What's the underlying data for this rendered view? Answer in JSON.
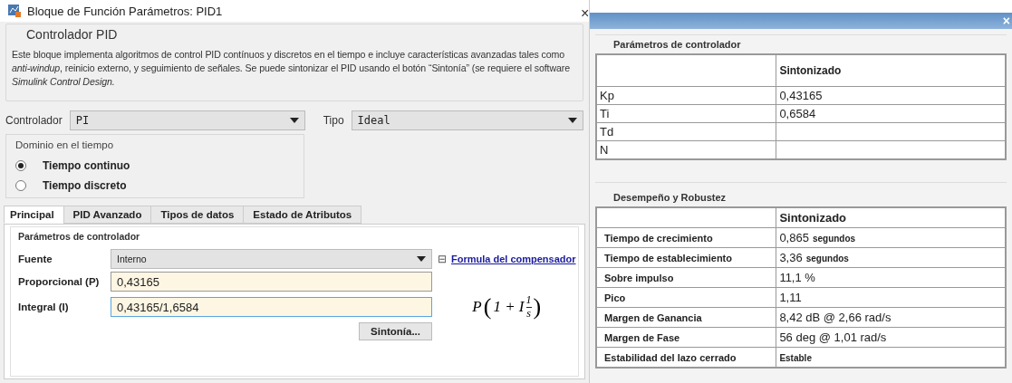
{
  "dialog": {
    "title": "Bloque de Función Parámetros: PID1",
    "close": "×",
    "section": {
      "title": "Controlador PID",
      "description": "Este bloque implementa algoritmos de control PID contínuos y discretos en el tiempo e incluye características avanzadas tales como *anti-windup*, reinicio externo, y seguimiento de señales. Se puede sintonizar el PID usando el botón “Sintonía” (se requiere el software *Simulink Control Design.*"
    },
    "controller": {
      "label": "Controlador",
      "value": "PI"
    },
    "type": {
      "label": "Tipo",
      "value": "Ideal"
    },
    "time_domain": {
      "title": "Dominio en el tiempo",
      "options": [
        {
          "label": "Tiempo continuo",
          "selected": true
        },
        {
          "label": "Tiempo discreto",
          "selected": false
        }
      ]
    },
    "tabs": [
      {
        "label": "Principal",
        "selected": true
      },
      {
        "label": "PID Avanzado",
        "selected": false
      },
      {
        "label": "Tipos de datos",
        "selected": false
      },
      {
        "label": "Estado de Atributos",
        "selected": false
      }
    ],
    "params": {
      "title": "Parámetros de controlador",
      "source": {
        "label": "Fuente",
        "value": "Interno"
      },
      "fields": [
        {
          "label": "Proporcional (P)",
          "value": "0,43165",
          "focused": false
        },
        {
          "label": "Integral (I)",
          "value": "0,43165/1,6584",
          "focused": true
        }
      ],
      "formula_toggle": "⊟",
      "formula_link": "Formula del compensador",
      "formula": {
        "lead": "P",
        "open": "(",
        "inner": "1 + I",
        "numerator": "1",
        "denominator": "s",
        "close": ")"
      },
      "tune_button": "Sintonía..."
    }
  },
  "results": {
    "close": "×",
    "controller_params": {
      "title": "Parámetros de controlador",
      "header": "Sintonizado",
      "rows": [
        {
          "name": "Kp",
          "value": "0,43165"
        },
        {
          "name": "Ti",
          "value": "0,6584"
        },
        {
          "name": "Td",
          "value": ""
        },
        {
          "name": "N",
          "value": ""
        }
      ]
    },
    "performance": {
      "title": "Desempeño y Robustez",
      "header": "Sintonizado",
      "rows": [
        {
          "name": "Tiempo de crecimiento",
          "value": "0,865",
          "unit": "segundos"
        },
        {
          "name": "Tiempo de establecimiento",
          "value": "3,36",
          "unit": "segundos"
        },
        {
          "name": "Sobre impulso",
          "value": "11,1 %"
        },
        {
          "name": "Pico",
          "value": "1,11"
        },
        {
          "name": "Margen de Ganancia",
          "value": "8,42 dB @ 2,66 rad/s"
        },
        {
          "name": "Margen de Fase",
          "value": "56 deg @ 1,01 rad/s"
        },
        {
          "name": "Estabilidad del lazo cerrado",
          "value": "Estable",
          "small": true
        }
      ]
    }
  }
}
